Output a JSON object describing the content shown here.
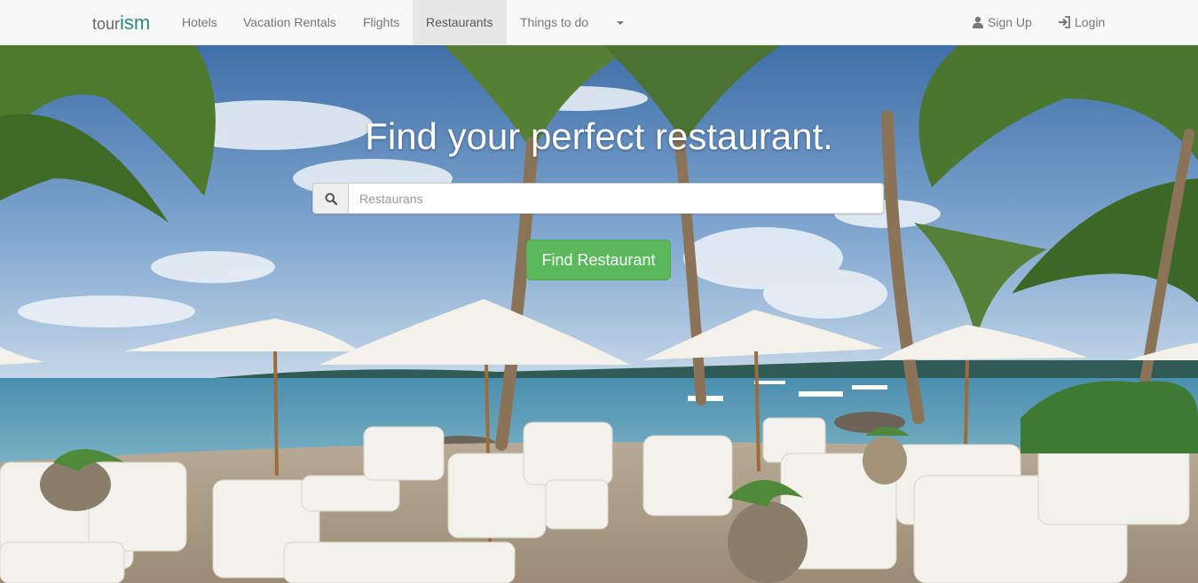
{
  "brand": {
    "part1": "tour",
    "part2": "ism"
  },
  "nav": {
    "items": [
      {
        "label": "Hotels"
      },
      {
        "label": "Vacation Rentals"
      },
      {
        "label": "Flights"
      },
      {
        "label": "Restaurants",
        "active": true
      },
      {
        "label": "Things to do"
      }
    ],
    "more_icon": "caret-down-icon",
    "signup": {
      "label": "Sign Up",
      "icon": "user-icon"
    },
    "login": {
      "label": "Login",
      "icon": "login-icon"
    }
  },
  "hero": {
    "headline": "Find your perfect restaurant.",
    "search": {
      "icon": "search-icon",
      "placeholder": "Restaurans",
      "value": ""
    },
    "button_label": "Find Restaurant"
  },
  "colors": {
    "brand_accent": "#2a8a7b",
    "button_green": "#5cb85c",
    "navbar_bg": "#f8f8f8",
    "active_tab_bg": "#e7e7e7"
  }
}
